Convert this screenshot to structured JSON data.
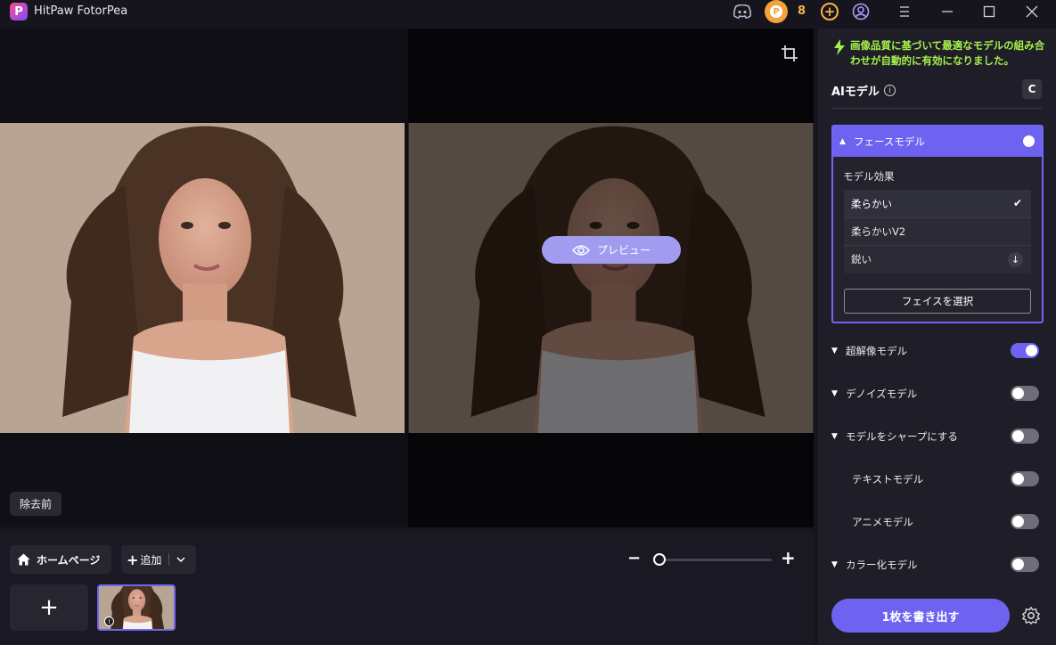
{
  "app": {
    "title": "HitPaw FotorPea",
    "logo_letter": "P",
    "credits": "8"
  },
  "canvas": {
    "preview_label": "プレビュー",
    "before_label": "除去前"
  },
  "bottom": {
    "home_label": "ホームページ",
    "add_label": "追加"
  },
  "panel": {
    "notice": "画像品質に基づいて最適なモデルの組み合わせが自動的に有効になりました。",
    "ai_title": "AIモデル",
    "reset_label": "C",
    "face_model": {
      "title": "フェースモデル",
      "enabled": true,
      "effect_label": "モデル効果",
      "options": [
        "柔らかい",
        "柔らかいV2",
        "鋭い"
      ],
      "selected": "柔らかい",
      "select_face_label": "フェイスを選択"
    },
    "models": [
      {
        "name": "超解像モデル",
        "enabled": true
      },
      {
        "name": "デノイズモデル",
        "enabled": false
      },
      {
        "name": "モデルをシャープにする",
        "enabled": false
      },
      {
        "name": "テキストモデル",
        "enabled": false
      },
      {
        "name": "アニメモデル",
        "enabled": false
      },
      {
        "name": "カラー化モデル",
        "enabled": false
      }
    ],
    "export_label": "1枚を書き出す"
  },
  "colors": {
    "accent": "#6e63f0",
    "notice_green": "#a5f04a",
    "coin": "#f2a43a"
  }
}
